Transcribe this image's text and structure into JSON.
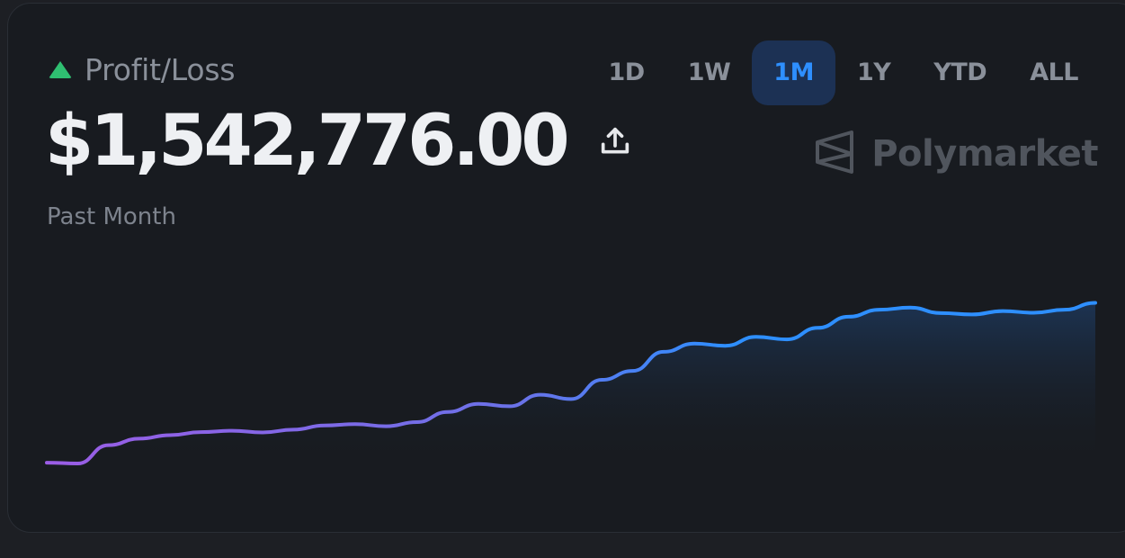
{
  "header": {
    "label": "Profit/Loss",
    "amount": "$1,542,776.00",
    "period": "Past Month"
  },
  "range_tabs": [
    {
      "label": "1D",
      "active": false
    },
    {
      "label": "1W",
      "active": false
    },
    {
      "label": "1M",
      "active": true
    },
    {
      "label": "1Y",
      "active": false
    },
    {
      "label": "YTD",
      "active": false
    },
    {
      "label": "ALL",
      "active": false
    }
  ],
  "brand": {
    "name": "Polymarket"
  },
  "icons": {
    "trend": "triangle-up-icon",
    "share": "share-icon",
    "logo": "polymarket-logo-icon"
  },
  "colors": {
    "positive": "#2fbf71",
    "accent": "#2e8fff",
    "line_start": "#9b5de5",
    "line_end": "#2e8fff"
  },
  "chart_data": {
    "type": "area",
    "values": [
      0.01,
      0.005,
      0.112,
      0.15,
      0.17,
      0.188,
      0.196,
      0.186,
      0.202,
      0.226,
      0.234,
      0.222,
      0.246,
      0.305,
      0.352,
      0.338,
      0.405,
      0.38,
      0.492,
      0.544,
      0.655,
      0.703,
      0.69,
      0.742,
      0.727,
      0.794,
      0.859,
      0.9,
      0.912,
      0.88,
      0.872,
      0.892,
      0.882,
      0.9,
      0.94
    ]
  }
}
